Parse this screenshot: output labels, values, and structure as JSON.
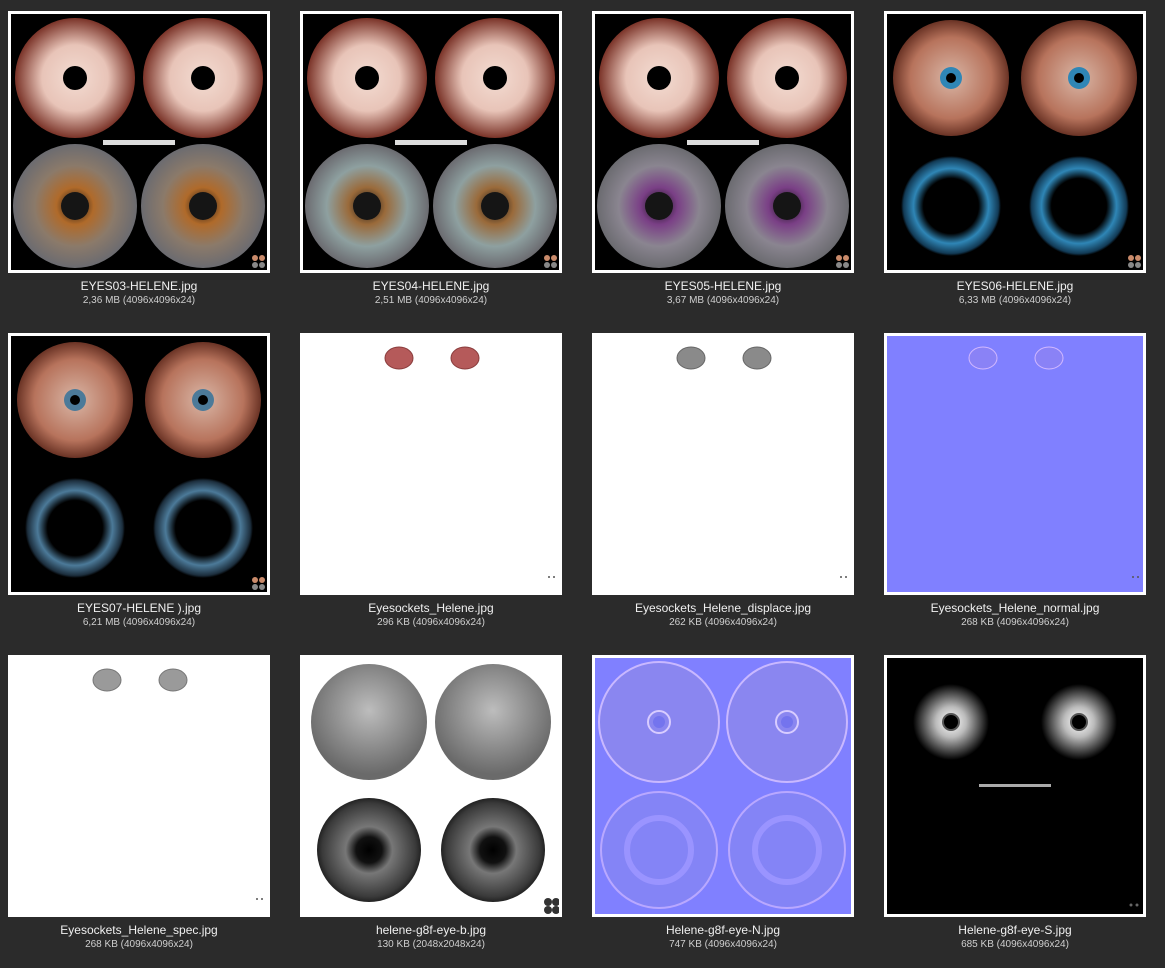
{
  "files": [
    {
      "name": "EYES03-HELENE.jpg",
      "info": "2,36 MB (4096x4096x24)",
      "thumb_type": "eyes-red-brown"
    },
    {
      "name": "EYES04-HELENE.jpg",
      "info": "2,51 MB (4096x4096x24)",
      "thumb_type": "eyes-red-green"
    },
    {
      "name": "EYES05-HELENE.jpg",
      "info": "3,67 MB (4096x4096x24)",
      "thumb_type": "eyes-red-purple"
    },
    {
      "name": "EYES06-HELENE.jpg",
      "info": "6,33 MB (4096x4096x24)",
      "thumb_type": "eyes-blue-ring"
    },
    {
      "name": "EYES07-HELENE ).jpg",
      "info": "6,21 MB (4096x4096x24)",
      "thumb_type": "eyes-blue-ring-dark"
    },
    {
      "name": "Eyesockets_Helene.jpg",
      "info": "296 KB (4096x4096x24)",
      "thumb_type": "socket-color"
    },
    {
      "name": "Eyesockets_Helene_displace.jpg",
      "info": "262 KB (4096x4096x24)",
      "thumb_type": "socket-gray"
    },
    {
      "name": "Eyesockets_Helene_normal.jpg",
      "info": "268 KB (4096x4096x24)",
      "thumb_type": "socket-normal"
    },
    {
      "name": "Eyesockets_Helene_spec.jpg",
      "info": "268 KB (4096x4096x24)",
      "thumb_type": "socket-spec"
    },
    {
      "name": "helene-g8f-eye-b.jpg",
      "info": "130 KB (2048x2048x24)",
      "thumb_type": "bump-gray"
    },
    {
      "name": "Helene-g8f-eye-N.jpg",
      "info": "747 KB (4096x4096x24)",
      "thumb_type": "normal-map"
    },
    {
      "name": "Helene-g8f-eye-S.jpg",
      "info": "685 KB (4096x4096x24)",
      "thumb_type": "specular-map"
    }
  ],
  "colors": {
    "background": "#2b2b2b",
    "thumb_border": "#ffffff",
    "normal_blue": "#8080ff",
    "socket_red": "#b55a5a"
  }
}
